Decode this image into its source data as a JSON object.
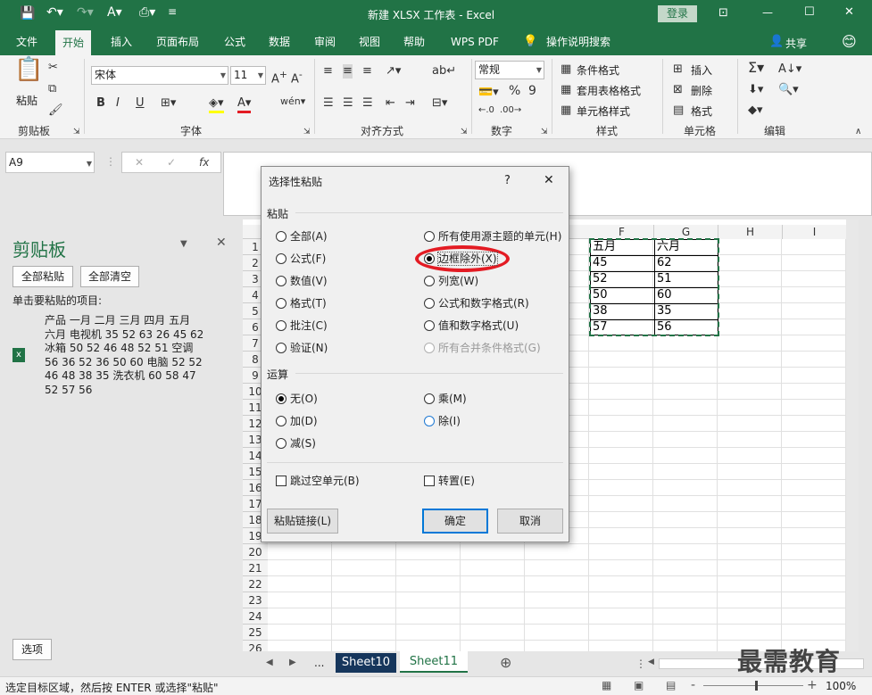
{
  "titlebar": {
    "title": "新建 XLSX 工作表 - Excel",
    "login": "登录",
    "minimize": "—",
    "maximize": "☐",
    "close": "✕",
    "ribbon_toggle": "⊡"
  },
  "tabs": [
    "文件",
    "开始",
    "插入",
    "页面布局",
    "公式",
    "数据",
    "审阅",
    "视图",
    "帮助",
    "WPS PDF",
    "操作说明搜索"
  ],
  "share": "共享",
  "ribbon": {
    "clipboard": {
      "label": "剪贴板",
      "paste": "粘贴"
    },
    "font": {
      "label": "字体",
      "name": "宋体",
      "size": "11",
      "bold": "B",
      "italic": "I",
      "underline": "U"
    },
    "align": {
      "label": "对齐方式"
    },
    "number": {
      "label": "数字",
      "format": "常规",
      "percent": "%",
      "comma": "9"
    },
    "styles": {
      "label": "样式",
      "cond": "条件格式",
      "table": "套用表格格式",
      "cell": "单元格样式"
    },
    "cells": {
      "label": "单元格",
      "insert": "插入",
      "delete": "删除",
      "format": "格式"
    },
    "edit": {
      "label": "编辑"
    }
  },
  "namebox": "A9",
  "fx": "fx",
  "clipboard_panel": {
    "title": "剪贴板",
    "paste_all": "全部粘贴",
    "clear_all": "全部清空",
    "hint": "单击要粘贴的项目:",
    "item_lines": [
      "产品 一月 二月 三月 四月 五月",
      "六月 电视机 35 52 63 26 45 62",
      "冰箱 50 52 46 48 52 51 空调",
      "56 36 52 36 50 60 电脑 52 52",
      "46 48 38 35 洗衣机 60 58 47",
      "52 57 56"
    ],
    "options": "选项"
  },
  "grid": {
    "col_headers": [
      "F",
      "G",
      "H",
      "I"
    ],
    "row_headers": [
      "1",
      "2",
      "3",
      "4",
      "5",
      "6",
      "7",
      "8",
      "9",
      "10",
      "11",
      "12",
      "13",
      "14",
      "15",
      "16",
      "17",
      "18",
      "19",
      "20",
      "21",
      "22",
      "23",
      "24",
      "25",
      "26"
    ],
    "f_values": [
      "五月",
      "45",
      "52",
      "50",
      "38",
      "57"
    ],
    "g_values": [
      "六月",
      "62",
      "51",
      "60",
      "35",
      "56"
    ]
  },
  "sheets": {
    "more": "...",
    "sheet10": "Sheet10",
    "sheet11": "Sheet11",
    "add": "⊕"
  },
  "status": {
    "text": "选定目标区域，然后按 ENTER 或选择\"粘贴\"",
    "zoom": "100%",
    "minus": "-",
    "plus": "+"
  },
  "watermark": "最需教育",
  "dialog": {
    "title": "选择性粘贴",
    "help": "?",
    "close": "✕",
    "paste_section": "粘贴",
    "paste_left": [
      "全部(A)",
      "公式(F)",
      "数值(V)",
      "格式(T)",
      "批注(C)",
      "验证(N)"
    ],
    "paste_right": [
      "所有使用源主题的单元(H)",
      "边框除外(X)",
      "列宽(W)",
      "公式和数字格式(R)",
      "值和数字格式(U)",
      "所有合并条件格式(G)"
    ],
    "op_section": "运算",
    "op_left": [
      "无(O)",
      "加(D)",
      "减(S)"
    ],
    "op_right": [
      "乘(M)",
      "除(I)"
    ],
    "skip_blanks": "跳过空单元(B)",
    "transpose": "转置(E)",
    "paste_link": "粘贴链接(L)",
    "ok": "确定",
    "cancel": "取消"
  },
  "colors": {
    "excel_green": "#217346",
    "highlight": "#e31b23",
    "dialog_bg": "#f0f0f0"
  }
}
